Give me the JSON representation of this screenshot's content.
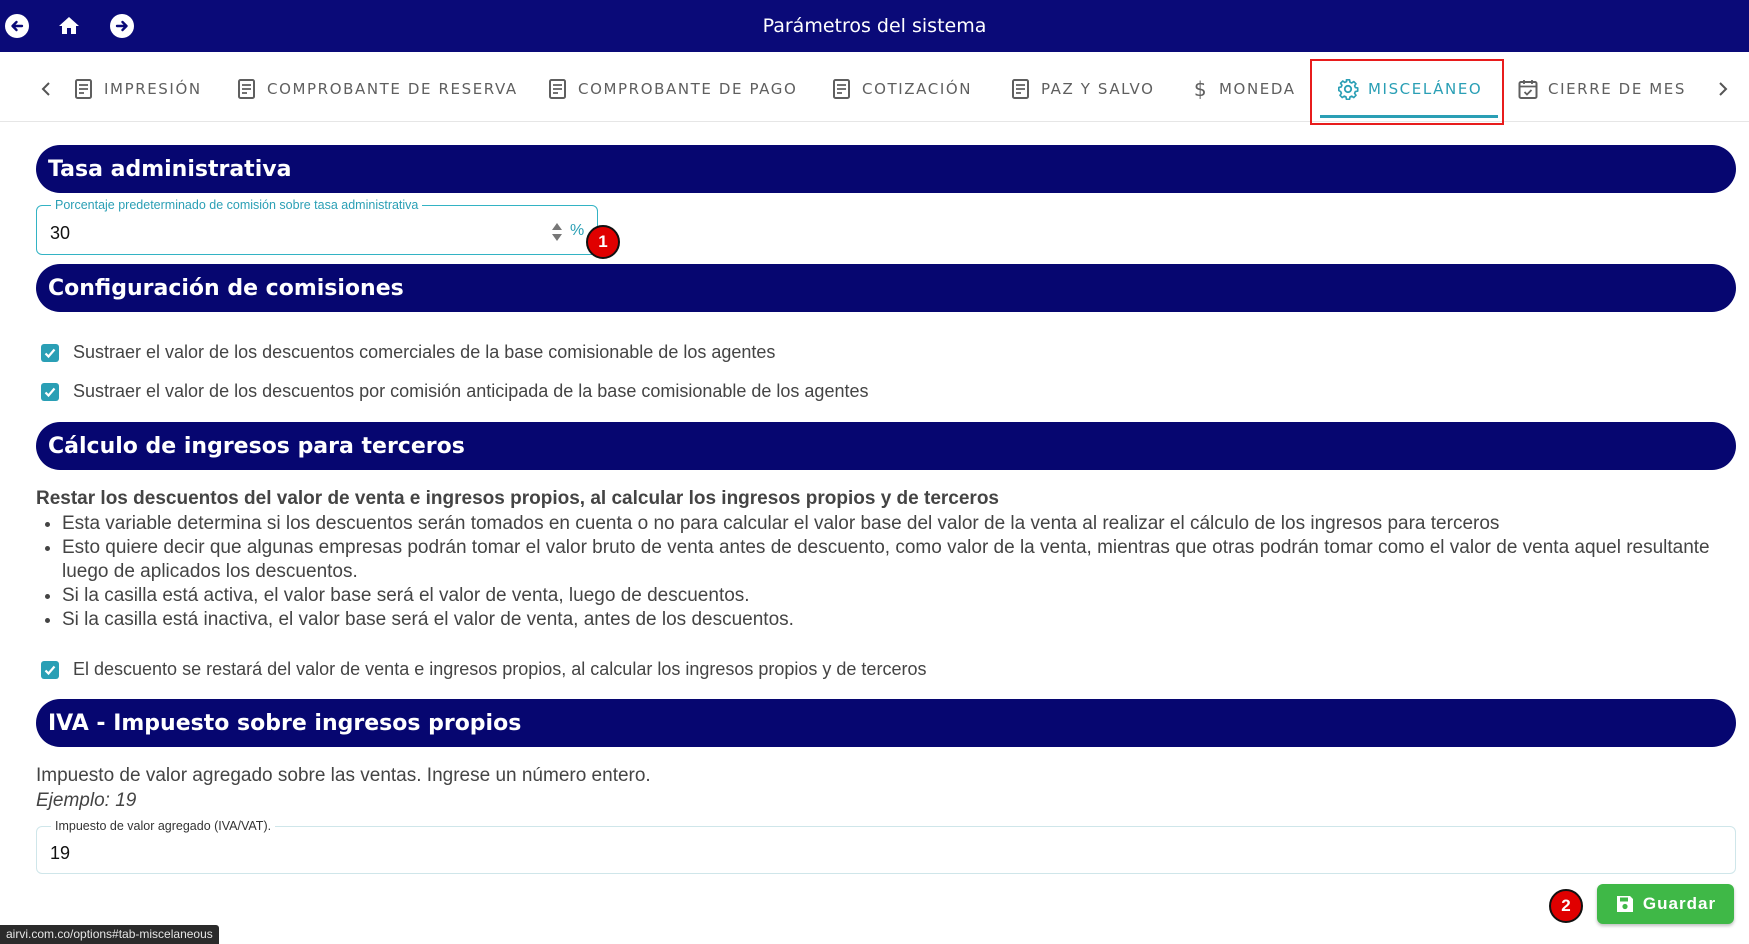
{
  "topbar": {
    "title": "Parámetros del sistema",
    "icons": [
      "back-icon",
      "home-icon",
      "forward-icon"
    ]
  },
  "tabs": [
    {
      "label": "IMPRESIÓN",
      "icon": "document-icon"
    },
    {
      "label": "COMPROBANTE DE RESERVA",
      "icon": "document-icon"
    },
    {
      "label": "COMPROBANTE DE PAGO",
      "icon": "document-icon"
    },
    {
      "label": "COTIZACIÓN",
      "icon": "document-icon"
    },
    {
      "label": "PAZ Y SALVO",
      "icon": "document-icon"
    },
    {
      "label": "MONEDA",
      "icon": "dollar-icon"
    },
    {
      "label": "MISCELÁNEO",
      "icon": "gear-icon",
      "active": true
    },
    {
      "label": "CIERRE DE MES",
      "icon": "calendar-icon"
    }
  ],
  "colors": {
    "navy": "#060670",
    "accent": "#2a9fb5",
    "save": "#3fb847",
    "badge": "#e00000"
  },
  "sections": {
    "tasa": {
      "title": "Tasa administrativa",
      "field_label": "Porcentaje predeterminado de comisión sobre tasa administrativa",
      "field_value": "30",
      "field_unit": "%",
      "badge": "1"
    },
    "comisiones": {
      "title": "Configuración de comisiones",
      "checks": [
        "Sustraer el valor de los descuentos comerciales de la base comisionable de los agentes",
        "Sustraer el valor de los descuentos por comisión anticipada de la base comisionable de los agentes"
      ]
    },
    "terceros": {
      "title": "Cálculo de ingresos para terceros",
      "heading": "Restar los descuentos del valor de venta e ingresos propios, al calcular los ingresos propios y de terceros",
      "bullets": [
        "Esta variable determina si los descuentos serán tomados en cuenta o no para calcular el valor base del valor de la venta al realizar el cálculo de los ingresos para terceros",
        "Esto quiere decir que algunas empresas podrán tomar el valor bruto de venta antes de descuento, como valor de la venta, mientras que otras podrán tomar como el valor de venta aquel resultante luego de aplicados los descuentos.",
        "Si la casilla está activa, el valor base será el valor de venta, luego de descuentos.",
        "Si la casilla está inactiva, el valor base será el valor de venta, antes de los descuentos."
      ],
      "check": "El descuento se restará del valor de venta e ingresos propios, al calcular los ingresos propios y de terceros"
    },
    "iva": {
      "title": "IVA - Impuesto sobre ingresos propios",
      "description": "Impuesto de valor agregado sobre las ventas. Ingrese un número entero.",
      "example": "Ejemplo: 19",
      "field_label": "Impuesto de valor agregado (IVA/VAT).",
      "field_value": "19"
    }
  },
  "save": {
    "label": "Guardar",
    "badge": "2"
  },
  "statusbar": "airvi.com.co/options#tab-miscelaneous"
}
